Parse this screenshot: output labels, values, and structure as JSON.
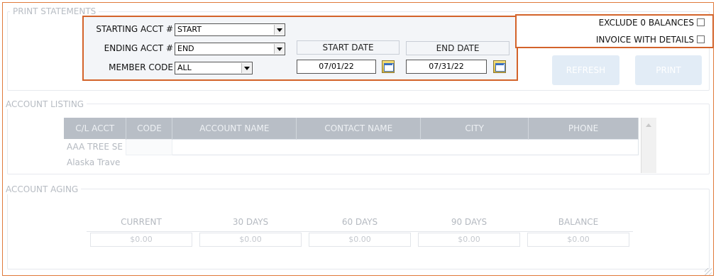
{
  "print_statements": {
    "legend": "PRINT STATEMENTS",
    "starting_acct_label": "STARTING ACCT #",
    "starting_acct_value": "START",
    "ending_acct_label": "ENDING ACCT #",
    "ending_acct_value": "END",
    "member_code_label": "MEMBER CODE",
    "member_code_value": "ALL",
    "start_date_header": "START DATE",
    "end_date_header": "END DATE",
    "start_date_value": "07/01/22",
    "end_date_value": "07/31/22",
    "exclude_zero_label": "EXCLUDE 0 BALANCES",
    "invoice_details_label": "INVOICE WITH DETAILS",
    "refresh_label": "REFRESH",
    "print_label": "PRINT"
  },
  "account_listing": {
    "legend": "ACCOUNT LISTING",
    "columns": [
      "C/L ACCT",
      "CODE",
      "ACCOUNT NAME",
      "CONTACT NAME",
      "CITY",
      "PHONE"
    ],
    "rows": [
      {
        "acct": "AAA TREE SE"
      },
      {
        "acct": "Alaska Trave"
      }
    ]
  },
  "account_aging": {
    "legend": "ACCOUNT AGING",
    "columns": [
      "CURRENT",
      "30 DAYS",
      "60 DAYS",
      "90 DAYS",
      "BALANCE"
    ],
    "values": [
      "$0.00",
      "$0.00",
      "$0.00",
      "$0.00",
      "$0.00"
    ]
  },
  "colors": {
    "highlight_border": "#d3632a",
    "outer_border": "#e07a3a",
    "header_bg": "#b8bec6"
  }
}
